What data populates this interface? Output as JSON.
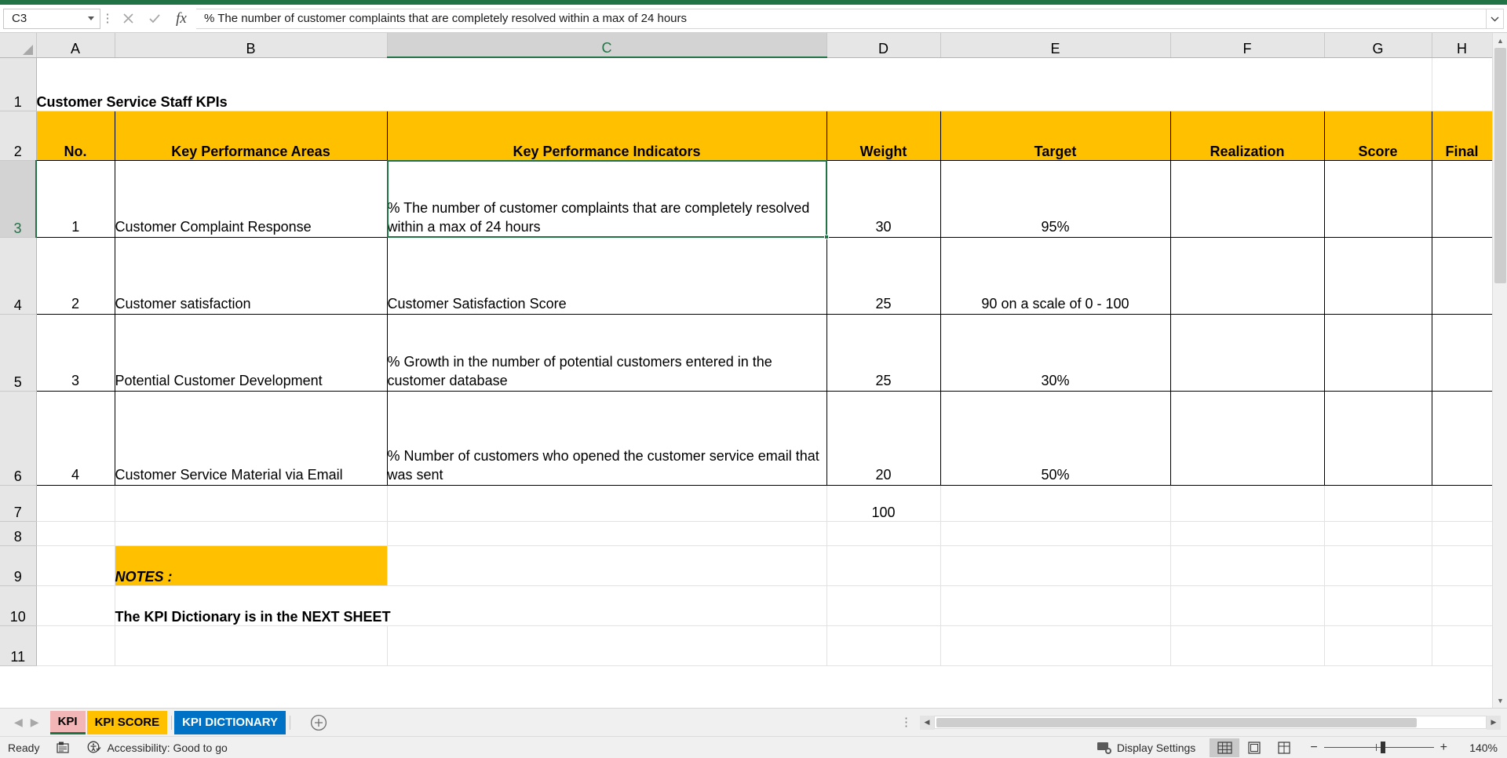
{
  "formula_bar": {
    "name_box_value": "C3",
    "cancel_icon": "close-icon",
    "confirm_icon": "check-icon",
    "fx_label": "fx",
    "formula_value": "% The number of customer complaints that are completely resolved within a max of 24 hours"
  },
  "grid": {
    "column_headers": [
      "A",
      "B",
      "C",
      "D",
      "E",
      "F",
      "G",
      "H"
    ],
    "selected_column": "C",
    "row_headers": [
      "1",
      "2",
      "3",
      "4",
      "5",
      "6",
      "7",
      "8",
      "9",
      "10",
      "11"
    ],
    "selected_row": "3",
    "title": "Customer Service Staff KPIs",
    "table_headers": {
      "no": "No.",
      "areas": "Key Performance Areas",
      "indicators": "Key Performance Indicators",
      "weight": "Weight",
      "target": "Target",
      "realization": "Realization",
      "score": "Score",
      "final": "Final"
    },
    "rows": [
      {
        "no": "1",
        "area": "Customer Complaint Response",
        "indicator": "% The number of customer complaints that are completely resolved within a max of 24 hours",
        "weight": "30",
        "target": "95%",
        "realization": "",
        "score": "",
        "final": ""
      },
      {
        "no": "2",
        "area": "Customer satisfaction",
        "indicator": "Customer Satisfaction Score",
        "weight": "25",
        "target": "90 on a scale of 0 - 100",
        "realization": "",
        "score": "",
        "final": ""
      },
      {
        "no": "3",
        "area": "Potential Customer Development",
        "indicator": "% Growth in the number of potential customers entered in the customer database",
        "weight": "25",
        "target": "30%",
        "realization": "",
        "score": "",
        "final": ""
      },
      {
        "no": "4",
        "area": "Customer Service Material via Email",
        "indicator": "% Number of customers who opened the customer service email that was sent",
        "weight": "20",
        "target": "50%",
        "realization": "",
        "score": "",
        "final": ""
      }
    ],
    "weight_total": "100",
    "notes_label": "NOTES :",
    "notes_text": "The KPI Dictionary is in the NEXT SHEET"
  },
  "sheet_tabs": {
    "prev_icon": "chevron-left-icon",
    "next_icon": "chevron-right-icon",
    "add_icon": "plus-icon",
    "tabs": [
      {
        "label": "KPI",
        "state": "active"
      },
      {
        "label": "KPI SCORE",
        "state": "yellow"
      },
      {
        "label": "KPI DICTIONARY",
        "state": "blue"
      }
    ]
  },
  "status_bar": {
    "ready_text": "Ready",
    "save_icon": "save-status-icon",
    "accessibility_icon": "accessibility-icon",
    "accessibility_text": "Accessibility: Good to go",
    "display_settings_icon": "display-settings-icon",
    "display_settings_text": "Display Settings",
    "view_normal_icon": "normal-view-icon",
    "view_pagelayout_icon": "page-layout-view-icon",
    "view_pagebreak_icon": "page-break-view-icon",
    "zoom_out_label": "−",
    "zoom_in_label": "+",
    "zoom_level": "140%"
  },
  "colors": {
    "accent_green": "#217346",
    "header_yellow": "#ffc000",
    "tab_blue": "#0072c6",
    "tab_active_pink": "#f2b6b6"
  }
}
